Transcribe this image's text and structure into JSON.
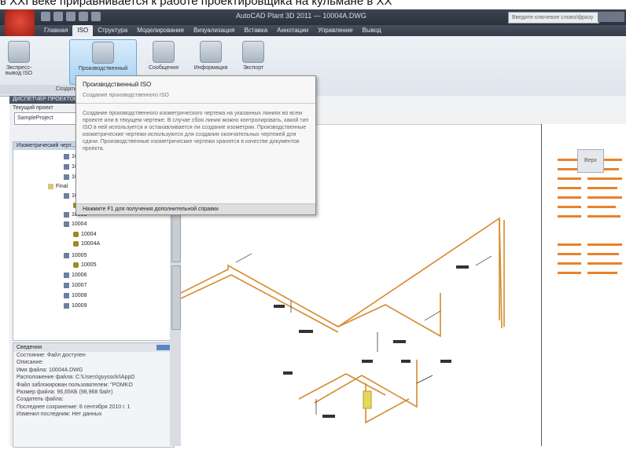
{
  "caption": "в XXI веке приравнивается к работе проектировщика на кульмане в XX",
  "app": {
    "title": "AutoCAD Plant 3D 2011 — 10004A.DWG",
    "search_placeholder": "Введите ключевое слово/фразу"
  },
  "ribbon_tabs": [
    "Главная",
    "ISO",
    "Структура",
    "Моделирование",
    "Визуализация",
    "Вставка",
    "Аннотации",
    "Управление",
    "Вывод"
  ],
  "ribbon_buttons": [
    {
      "label": "Экспресс-вывод ISO",
      "icon": "express-iso-icon"
    },
    {
      "label": "Производственный",
      "icon": "production-iso-icon"
    },
    {
      "label": "Сообщения",
      "icon": "messages-icon"
    },
    {
      "label": "Информация",
      "icon": "info-icon"
    },
    {
      "label": "Экспорт",
      "icon": "export-icon"
    }
  ],
  "ribbon_group": "Создать ISO",
  "tooltip": {
    "title": "Производственный ISO",
    "subtitle": "Создание производственного ISO",
    "body": "Создание производственного изометрического чертежа на указанных линиях во всем проекте или в текущем чертеже. В случае сбоя линии можно контролировать, какой тип ISO в ней используется и останавливается ли создание изометрии. Производственные изометрические чертежи используются для создания окончательных чертежей для сдачи. Производственные изометрические чертежи хранятся в качестве документов проекта.",
    "help": "Нажмите F1 для получения дополнительной справки"
  },
  "left_panel": {
    "header": "ДИСПЕТЧЕР ПРОЕКТОВ",
    "current_project_label": "Текущий проект",
    "project": "SampleProject",
    "tree_header": "Изометрический черт...",
    "tree": [
      "10001",
      "10002",
      "10003",
      "Final",
      "10001",
      "10004",
      "10003",
      "10004",
      "10004",
      "10004A",
      "10005",
      "10005",
      "10006",
      "10007",
      "10008",
      "10009"
    ],
    "vertical_tabs": [
      "Данные",
      "Изометрический..."
    ]
  },
  "details": {
    "title": "Сведения",
    "lines": [
      "Состояние: Файл доступен",
      "Описание:",
      "Имя файла: 10004A.DWG",
      "Расположение файла: C:\\Users\\gvysocki\\AppD",
      "Файл заблокирован пользователем: \"POMKO",
      "Размер файла: 96,65КБ (98,968 байт)",
      "Создатель файла:",
      "Последнее сохранение: 8 сентября 2010 г. 1",
      "Изменил последним: Нет данных"
    ]
  },
  "viewcube": "Верх"
}
